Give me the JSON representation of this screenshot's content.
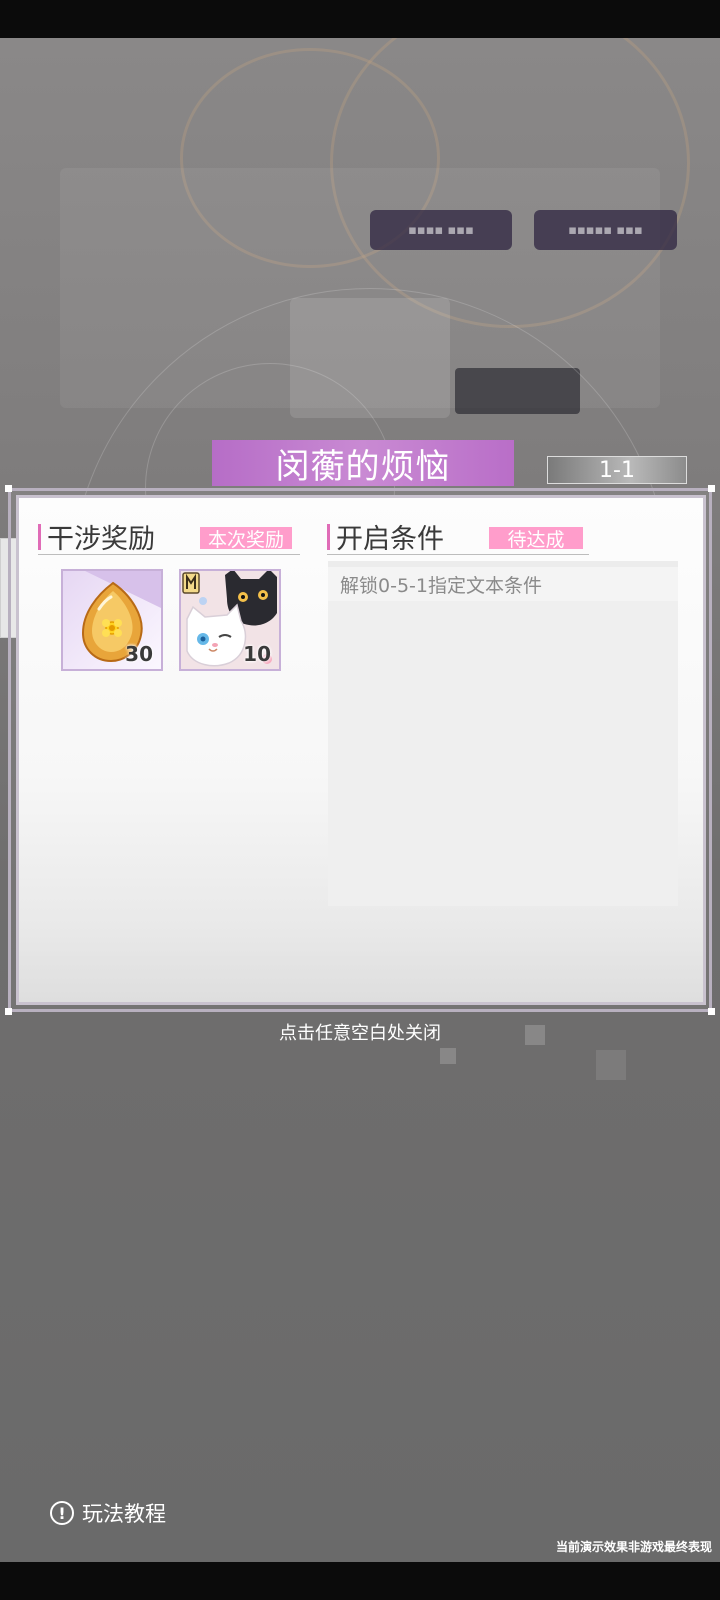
{
  "stage": {
    "title": "闵蘅的烦恼",
    "code": "1-1"
  },
  "rewards_section": {
    "label": "干涉奖励",
    "tag": "本次奖励",
    "items": [
      {
        "name": "amber-gem",
        "count": "30"
      },
      {
        "name": "cat-card",
        "count": "10"
      }
    ]
  },
  "conditions_section": {
    "label": "开启条件",
    "tag": "待达成",
    "items": [
      "解锁0-5-1指定文本条件"
    ]
  },
  "hints": {
    "close": "点击任意空白处关闭",
    "tutorial": "玩法教程",
    "tutorial_icon": "!",
    "disclaimer": "当前演示效果非游戏最终表现"
  },
  "colors": {
    "accent_pink": "#ff9dcb",
    "banner_purple": "#c98ad3"
  }
}
